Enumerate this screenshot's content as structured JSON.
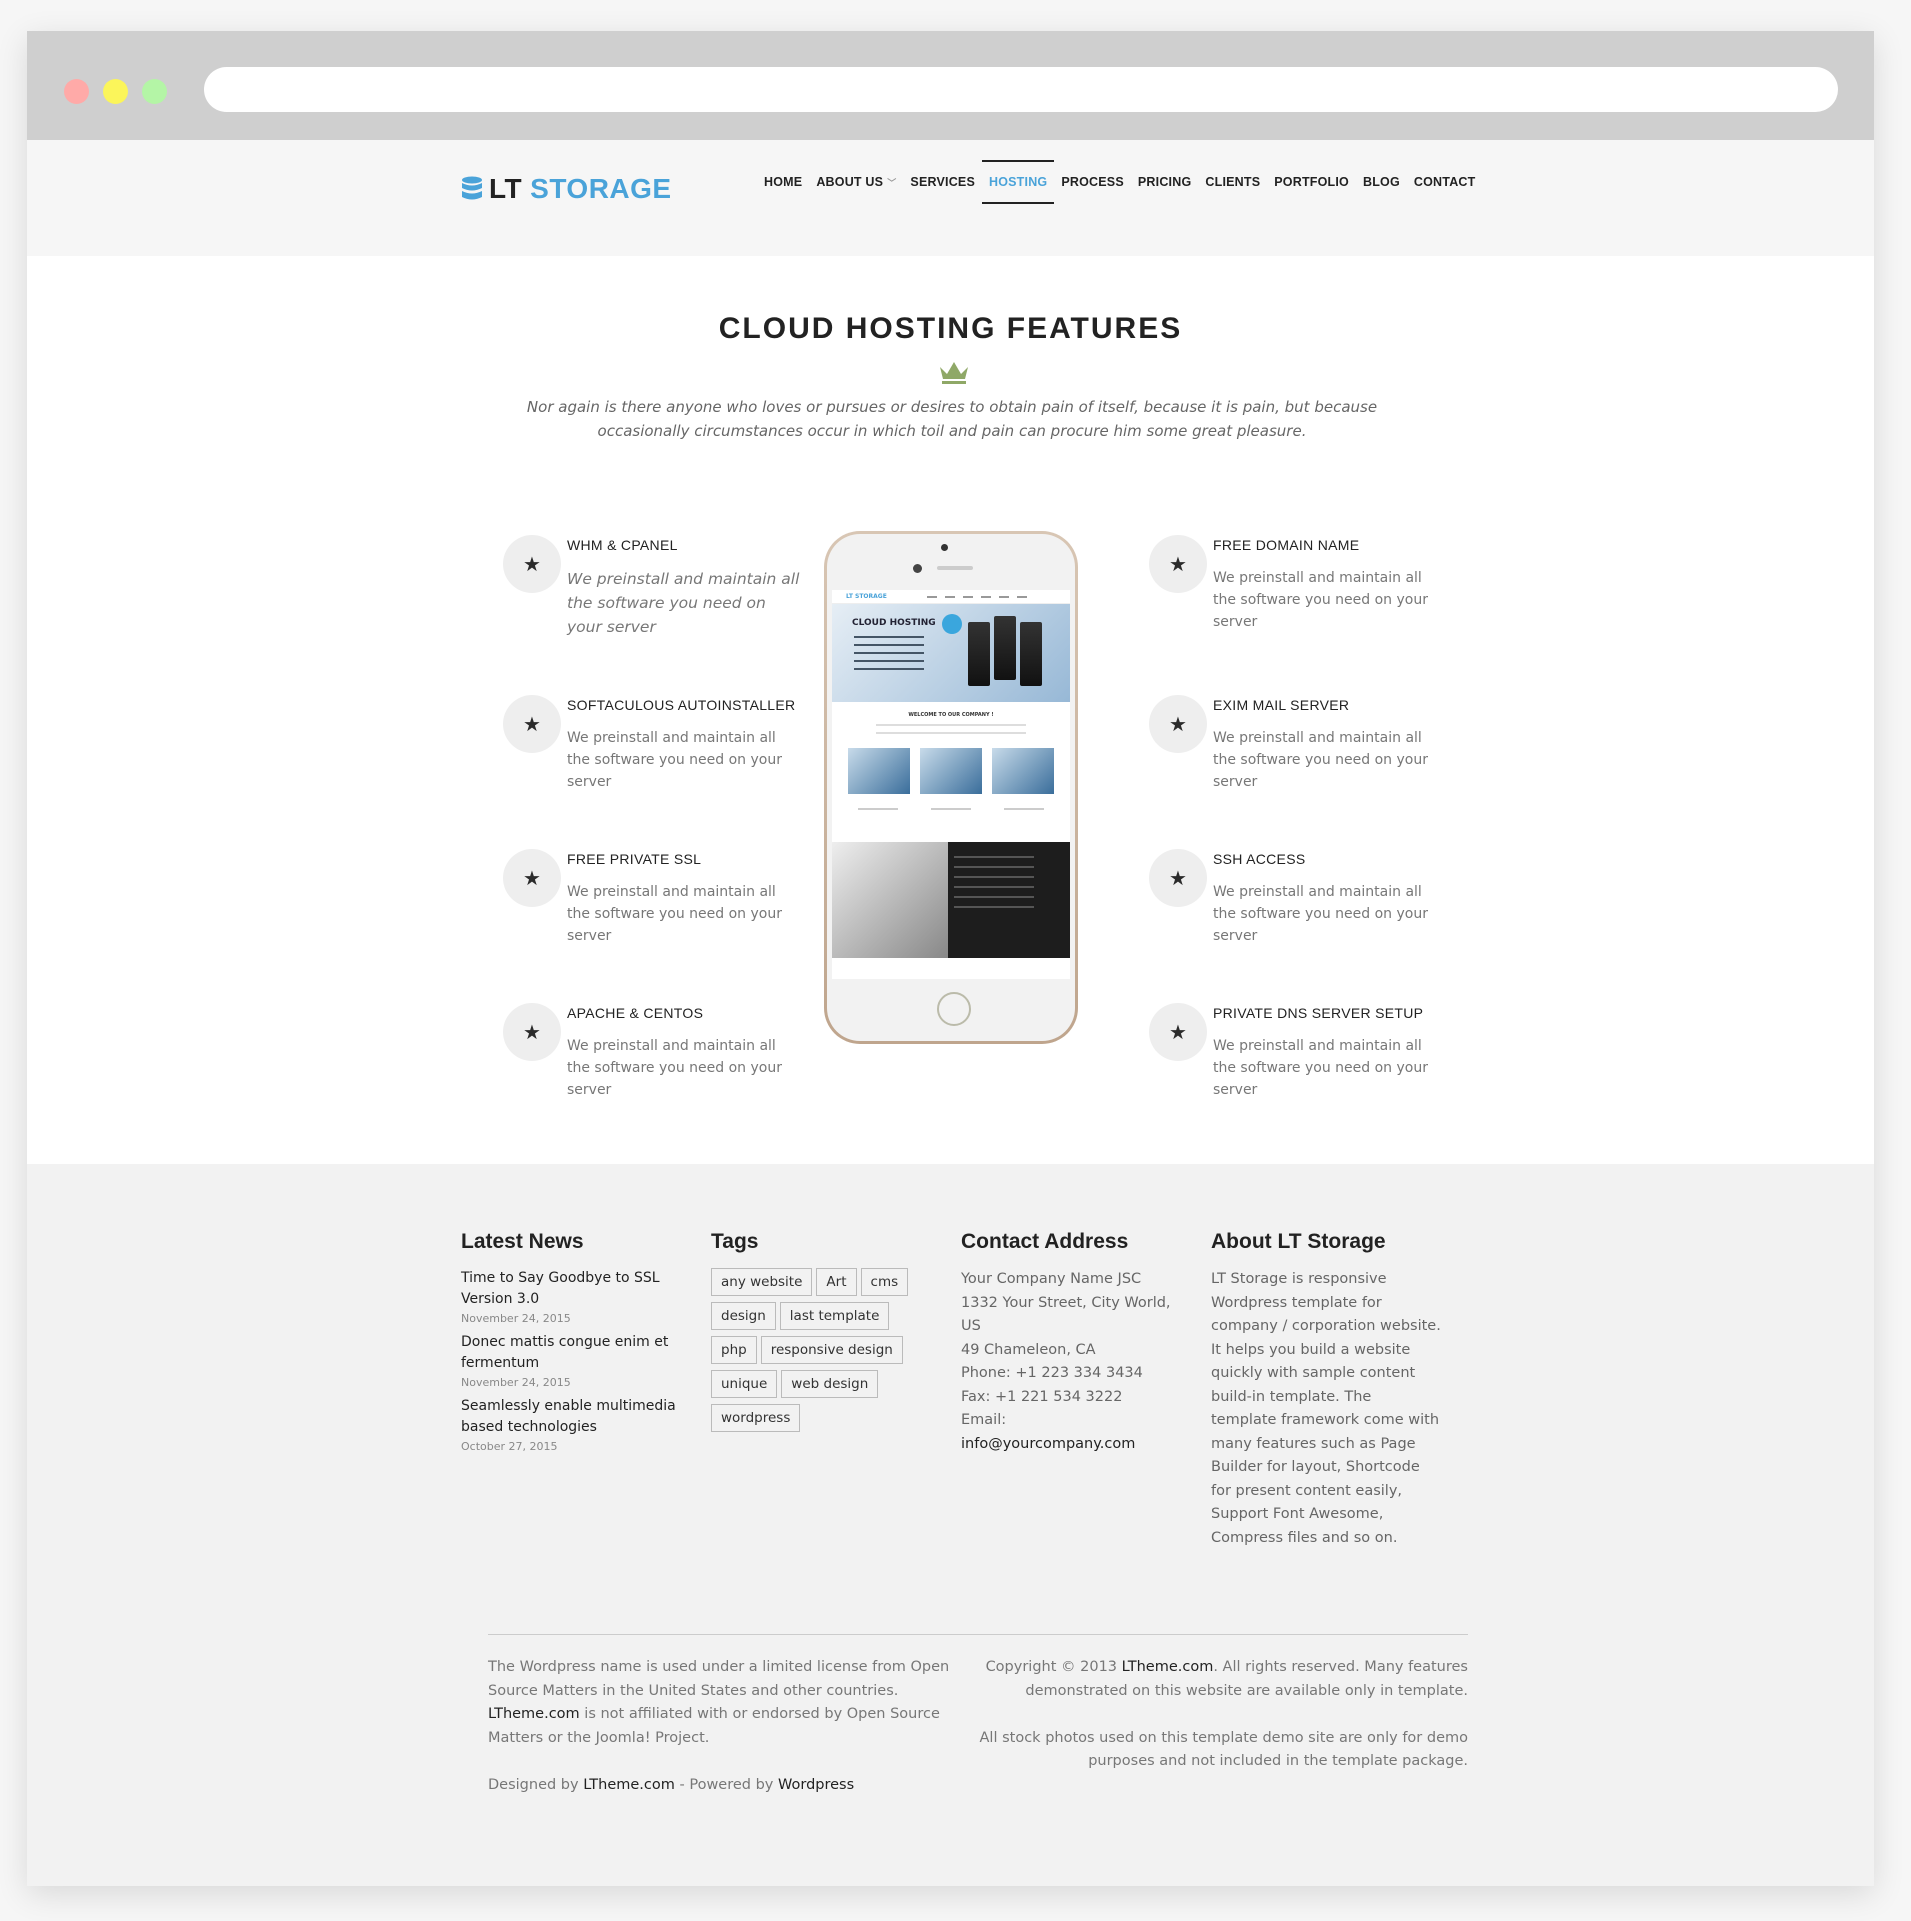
{
  "header": {
    "logo_lt": "LT",
    "logo_storage": "STORAGE",
    "nav": [
      {
        "label": "HOME"
      },
      {
        "label": "ABOUT US",
        "has_dropdown": true
      },
      {
        "label": "SERVICES"
      },
      {
        "label": "HOSTING",
        "active": true
      },
      {
        "label": "PROCESS"
      },
      {
        "label": "PRICING"
      },
      {
        "label": "CLIENTS"
      },
      {
        "label": "PORTFOLIO"
      },
      {
        "label": "BLOG"
      },
      {
        "label": "CONTACT"
      }
    ]
  },
  "section": {
    "title": "CLOUD HOSTING FEATURES",
    "intro": "Nor again is there anyone who loves or pursues or desires to obtain pain of itself, because it is pain, but because occasionally circumstances occur in which toil and pain can procure him some great pleasure."
  },
  "features_left": [
    {
      "title": "WHM & CPANEL",
      "desc": "We preinstall and maintain all the software you need on your server"
    },
    {
      "title": "SOFTACULOUS AUTOINSTALLER",
      "desc": "We preinstall and maintain all the software you need on your server"
    },
    {
      "title": "FREE PRIVATE SSL",
      "desc": "We preinstall and maintain all the software you need on your server"
    },
    {
      "title": "APACHE & CENTOS",
      "desc": "We preinstall and maintain all the software you need on your server"
    }
  ],
  "features_right": [
    {
      "title": "FREE DOMAIN NAME",
      "desc": "We preinstall and maintain all the software you need on your server"
    },
    {
      "title": "EXIM MAIL SERVER",
      "desc": "We preinstall and maintain all the software you need on your server"
    },
    {
      "title": "SSH ACCESS",
      "desc": "We preinstall and maintain all the software you need on your server"
    },
    {
      "title": "PRIVATE DNS SERVER SETUP",
      "desc": "We preinstall and maintain all the software you need on your server"
    }
  ],
  "phone_screen": {
    "logo": "LT STORAGE",
    "hero_title": "CLOUD HOSTING",
    "welcome": "WELCOME TO OUR COMPANY !"
  },
  "footer": {
    "news_heading": "Latest News",
    "news": [
      {
        "title": "Time to Say Goodbye to SSL Version 3.0",
        "date": "November 24, 2015"
      },
      {
        "title": "Donec mattis congue enim et fermentum",
        "date": "November 24, 2015"
      },
      {
        "title": "Seamlessly enable multimedia based technologies",
        "date": "October 27, 2015"
      }
    ],
    "tags_heading": "Tags",
    "tags": [
      "any website",
      "Art",
      "cms",
      "design",
      "last template",
      "php",
      "responsive design",
      "unique",
      "web design",
      "wordpress"
    ],
    "contact_heading": "Contact Address",
    "contact": {
      "company": "Your Company Name JSC",
      "street": "1332 Your Street, City World, US",
      "city": "49 Chameleon, CA",
      "phone": "Phone: +1 223 334 3434",
      "fax": "Fax: +1 221 534 3222",
      "email_label": "Email:",
      "email": "info@yourcompany.com"
    },
    "about_heading": "About LT Storage",
    "about_text": "LT Storage is responsive Wordpress template for company / corporation website. It helps you build a website quickly with sample content build-in template. The template framework come with many features such as Page Builder for layout, Shortcode for present content easily, Support Font Awesome, Compress files and so on.",
    "license_1": "The Wordpress name is used under a limited license from Open Source Matters in the United States and other countries.",
    "license_link": "LTheme.com",
    "license_2": "is not affiliated with or endorsed by Open Source Matters or the Joomla! Project.",
    "designed_by": "Designed by",
    "designed_link": "LTheme.com",
    "powered_by": "- Powered by",
    "powered_link": "Wordpress",
    "copyright_1": "Copyright © 2013",
    "copyright_link": "LTheme.com",
    "copyright_2": ". All rights reserved. Many features demonstrated on this website are available only in template.",
    "stock_note": "All stock photos used on this template demo site are only for demo purposes and not included in the template package."
  },
  "colors": {
    "accent": "#4aa3d9",
    "crown": "#8fa867",
    "dark": "#222222"
  }
}
